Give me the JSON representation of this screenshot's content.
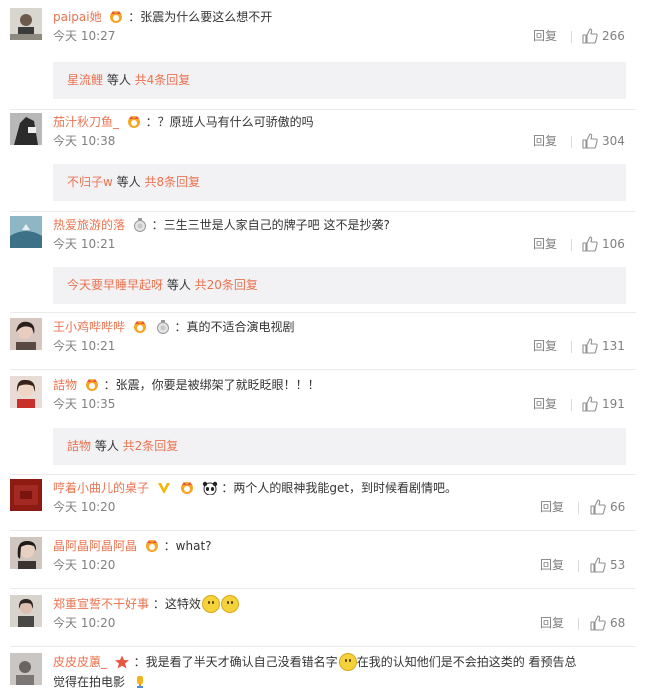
{
  "comments": [
    {
      "username": "paipai她",
      "badges": [
        "fan-badge"
      ],
      "text": "：张震为什么要这么想不开",
      "time": "今天 10:27",
      "reply_label": "回复",
      "likes": "266",
      "sub": {
        "name": "星流鲤",
        "etc": " 等人 ",
        "count": "共4条回复"
      }
    },
    {
      "username": "茄汁秋刀鱼_",
      "badges": [
        "fan-badge"
      ],
      "text": "：？原班人马有什么可骄傲的吗",
      "time": "今天 10:38",
      "reply_label": "回复",
      "likes": "304",
      "sub": {
        "name": "不归子w",
        "etc": " 等人 ",
        "count": "共8条回复"
      }
    },
    {
      "username": "热爱旅游的落",
      "badges": [
        "medal-badge"
      ],
      "text": "：三生三世是人家自己的牌子吧 这不是抄袭?",
      "time": "今天 10:21",
      "reply_label": "回复",
      "likes": "106",
      "sub": {
        "name": "今天要早睡早起呀",
        "etc": " 等人 ",
        "count": "共20条回复"
      }
    },
    {
      "username": "王小鸡哔哔哔",
      "badges": [
        "fan-badge",
        "medal-badge"
      ],
      "text": "：真的不适合演电视剧",
      "time": "今天 10:21",
      "reply_label": "回复",
      "likes": "131"
    },
    {
      "username": "詰物",
      "badges": [
        "fan-badge"
      ],
      "text": "：张震，你要是被绑架了就眨眨眼！！！",
      "time": "今天 10:35",
      "reply_label": "回复",
      "likes": "191",
      "sub": {
        "name": "詰物",
        "etc": " 等人 ",
        "count": "共2条回复"
      }
    },
    {
      "username": "哼着小曲儿的桌子",
      "badges": [
        "v-badge",
        "fan-badge",
        "panda-badge"
      ],
      "text": "：两个人的眼神我能get，到时候看剧情吧。",
      "time": "今天 10:20",
      "reply_label": "回复",
      "likes": "66"
    },
    {
      "username": "晶阿晶阿晶阿晶",
      "badges": [
        "fan-badge"
      ],
      "text": "：what?",
      "time": "今天 10:20",
      "reply_label": "回复",
      "likes": "53"
    },
    {
      "username": "郑重宣誓不干好事",
      "badges": [],
      "text": "：这特效",
      "emoji": [
        "smile-emoji",
        "smile-emoji"
      ],
      "time": "今天 10:20",
      "reply_label": "回复",
      "likes": "68"
    },
    {
      "username": "皮皮皮蕙_",
      "badges": [
        "star-badge"
      ],
      "text": "：我是看了半天才确认自己没看错名字",
      "text_after_emoji": "在我的认知他们是不会拍这类的 看预告总",
      "text_line2": "觉得在拍电影",
      "emoji": [
        "laugh-emoji"
      ],
      "time": "",
      "reply_label": "",
      "likes": ""
    }
  ]
}
